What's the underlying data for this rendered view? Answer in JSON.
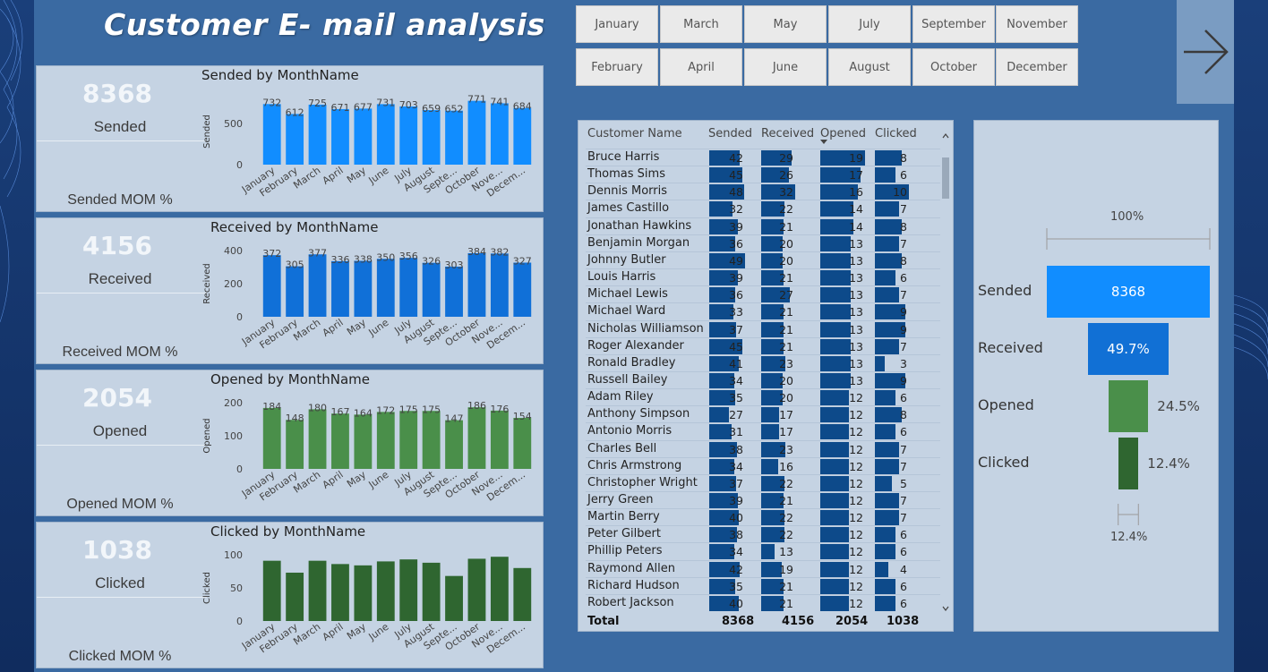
{
  "title": "Customer E- mail analysis",
  "months_row1": [
    "January",
    "March",
    "May",
    "July",
    "September",
    "November"
  ],
  "months_row2": [
    "February",
    "April",
    "June",
    "August",
    "October",
    "December"
  ],
  "nav_icon": "arrow-right-icon",
  "month_ticks": [
    "January",
    "February",
    "March",
    "April",
    "May",
    "June",
    "July",
    "August",
    "Septe...",
    "October",
    "Nove...",
    "Decem..."
  ],
  "cards": [
    {
      "value": "8368",
      "label": "Sended",
      "mom": "Sended MOM %",
      "chart_title": "Sended by MonthName",
      "ylabel": "Sended"
    },
    {
      "value": "4156",
      "label": "Received",
      "mom": "Received MOM %",
      "chart_title": "Received by MonthName",
      "ylabel": "Received"
    },
    {
      "value": "2054",
      "label": "Opened",
      "mom": "Opened MOM %",
      "chart_title": "Opened by MonthName",
      "ylabel": "Opened"
    },
    {
      "value": "1038",
      "label": "Clicked",
      "mom": "Clicked MOM %",
      "chart_title": "Clicked by MonthName",
      "ylabel": "Clicked"
    }
  ],
  "chart_data": [
    {
      "type": "bar",
      "title": "Sended by MonthName",
      "ylabel": "Sended",
      "categories": [
        "January",
        "February",
        "March",
        "April",
        "May",
        "June",
        "July",
        "August",
        "September",
        "October",
        "November",
        "December"
      ],
      "values": [
        732,
        612,
        725,
        671,
        677,
        731,
        703,
        659,
        652,
        771,
        741,
        684
      ],
      "ylim": [
        0,
        800
      ],
      "yticks": [
        0,
        500
      ],
      "color": "#118dff",
      "show_labels": true
    },
    {
      "type": "bar",
      "title": "Received by MonthName",
      "ylabel": "Received",
      "categories": [
        "January",
        "February",
        "March",
        "April",
        "May",
        "June",
        "July",
        "August",
        "September",
        "October",
        "November",
        "December"
      ],
      "values": [
        372,
        305,
        377,
        336,
        338,
        350,
        356,
        326,
        303,
        384,
        382,
        327
      ],
      "ylim": [
        0,
        400
      ],
      "yticks": [
        0,
        200,
        400
      ],
      "color": "#1070d8",
      "show_labels": true
    },
    {
      "type": "bar",
      "title": "Opened by MonthName",
      "ylabel": "Opened",
      "categories": [
        "January",
        "February",
        "March",
        "April",
        "May",
        "June",
        "July",
        "August",
        "September",
        "October",
        "November",
        "December"
      ],
      "values": [
        184,
        148,
        180,
        167,
        164,
        172,
        175,
        175,
        147,
        186,
        176,
        154
      ],
      "ylim": [
        0,
        200
      ],
      "yticks": [
        0,
        100,
        200
      ],
      "color": "#4a8f4a",
      "show_labels": true
    },
    {
      "type": "bar",
      "title": "Clicked by MonthName",
      "ylabel": "Clicked",
      "categories": [
        "January",
        "February",
        "March",
        "April",
        "May",
        "June",
        "July",
        "August",
        "September",
        "October",
        "November",
        "December"
      ],
      "values": [
        91,
        73,
        91,
        86,
        84,
        90,
        93,
        88,
        68,
        94,
        97,
        80
      ],
      "ylim": [
        0,
        100
      ],
      "yticks": [
        0,
        50,
        100
      ],
      "color": "#2f6630",
      "show_labels": false
    }
  ],
  "table": {
    "headers": [
      "Customer Name",
      "Sended",
      "Received",
      "Opened",
      "Clicked"
    ],
    "sort_icon": "sort-desc-icon",
    "rows": [
      [
        "Bruce Harris",
        42,
        29,
        19,
        8
      ],
      [
        "Thomas Sims",
        45,
        26,
        17,
        6
      ],
      [
        "Dennis Morris",
        48,
        32,
        16,
        10
      ],
      [
        "James Castillo",
        32,
        22,
        14,
        7
      ],
      [
        "Jonathan Hawkins",
        39,
        21,
        14,
        8
      ],
      [
        "Benjamin Morgan",
        36,
        20,
        13,
        7
      ],
      [
        "Johnny Butler",
        49,
        20,
        13,
        8
      ],
      [
        "Louis Harris",
        39,
        21,
        13,
        6
      ],
      [
        "Michael Lewis",
        36,
        27,
        13,
        7
      ],
      [
        "Michael Ward",
        33,
        21,
        13,
        9
      ],
      [
        "Nicholas Williamson",
        37,
        21,
        13,
        9
      ],
      [
        "Roger Alexander",
        45,
        21,
        13,
        7
      ],
      [
        "Ronald Bradley",
        41,
        23,
        13,
        3
      ],
      [
        "Russell Bailey",
        34,
        20,
        13,
        9
      ],
      [
        "Adam Riley",
        35,
        20,
        12,
        6
      ],
      [
        "Anthony Simpson",
        27,
        17,
        12,
        8
      ],
      [
        "Antonio Morris",
        31,
        17,
        12,
        6
      ],
      [
        "Charles Bell",
        38,
        23,
        12,
        7
      ],
      [
        "Chris Armstrong",
        34,
        16,
        12,
        7
      ],
      [
        "Christopher Wright",
        37,
        22,
        12,
        5
      ],
      [
        "Jerry Green",
        39,
        21,
        12,
        7
      ],
      [
        "Martin Berry",
        40,
        22,
        12,
        7
      ],
      [
        "Peter Gilbert",
        38,
        22,
        12,
        6
      ],
      [
        "Phillip Peters",
        34,
        13,
        12,
        6
      ],
      [
        "Raymond Allen",
        42,
        19,
        12,
        4
      ],
      [
        "Richard Hudson",
        35,
        21,
        12,
        6
      ],
      [
        "Robert Jackson",
        40,
        21,
        12,
        6
      ]
    ],
    "bar_max": [
      49,
      32,
      19,
      10
    ],
    "total_label": "Total",
    "totals": [
      "8368",
      "4156",
      "2054",
      "1038"
    ]
  },
  "funnel": {
    "top_pct": "100%",
    "bottom_pct": "12.4%",
    "stages": [
      {
        "label": "Sended",
        "value": "8368",
        "fraction": 1.0,
        "color": "#118dff",
        "text_inside": true
      },
      {
        "label": "Received",
        "value": "49.7%",
        "fraction": 0.497,
        "color": "#1170d5",
        "text_inside": true
      },
      {
        "label": "Opened",
        "value": "24.5%",
        "fraction": 0.245,
        "color": "#4a8f4a",
        "text_inside": false
      },
      {
        "label": "Clicked",
        "value": "12.4%",
        "fraction": 0.124,
        "color": "#2f6630",
        "text_inside": false
      }
    ]
  }
}
